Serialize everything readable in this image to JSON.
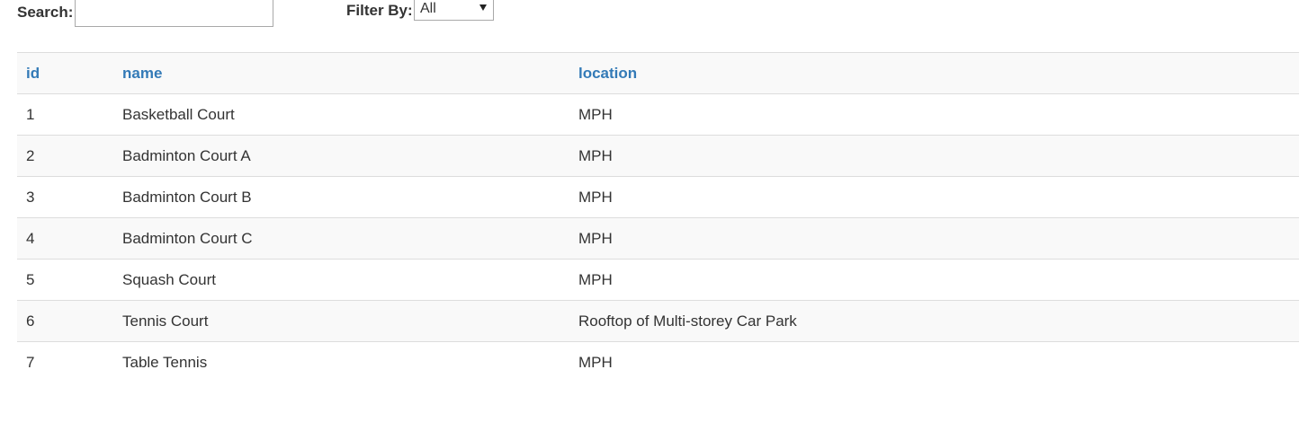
{
  "controls": {
    "search_label": "Search:",
    "search_value": "",
    "filter_label": "Filter By:",
    "filter_selected": "All"
  },
  "table": {
    "headers": [
      "id",
      "name",
      "location"
    ],
    "rows": [
      [
        "1",
        "Basketball Court",
        "MPH"
      ],
      [
        "2",
        "Badminton Court A",
        "MPH"
      ],
      [
        "3",
        "Badminton Court B",
        "MPH"
      ],
      [
        "4",
        "Badminton Court C",
        "MPH"
      ],
      [
        "5",
        "Squash Court",
        "MPH"
      ],
      [
        "6",
        "Tennis Court",
        "Rooftop of Multi-storey Car Park"
      ],
      [
        "7",
        "Table Tennis",
        "MPH"
      ]
    ]
  },
  "colors": {
    "header_link": "#337ab7",
    "stripe": "#f9f9f9",
    "border": "#dddddd",
    "text": "#333333"
  }
}
